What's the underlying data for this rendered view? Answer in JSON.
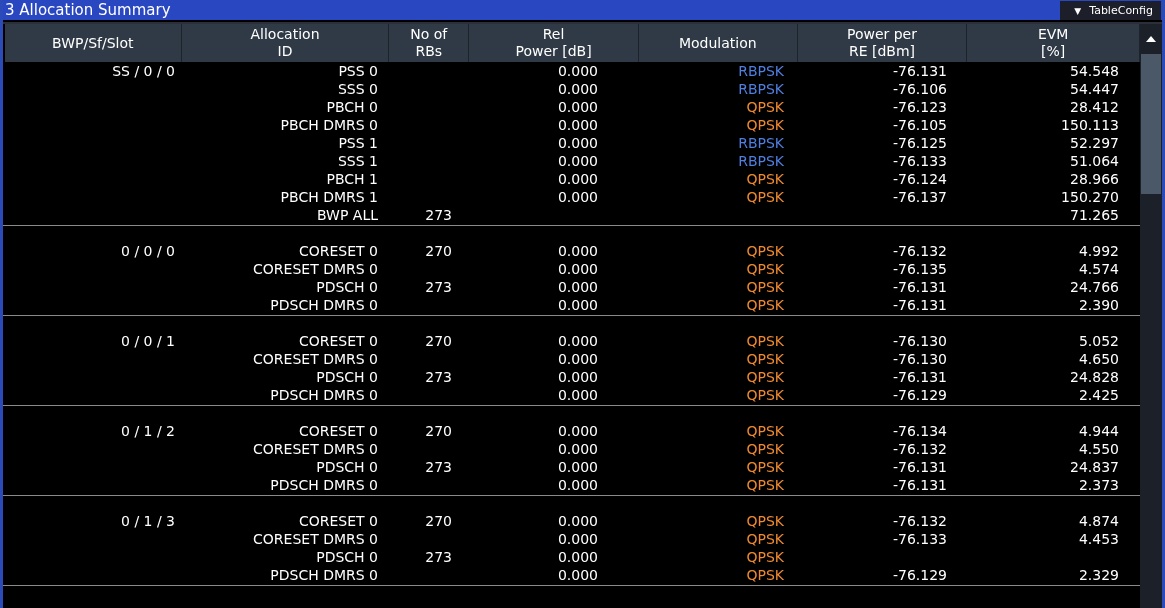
{
  "window": {
    "title": "3 Allocation Summary",
    "config_button": "TableConfig",
    "config_caret": "▼"
  },
  "table": {
    "columns": [
      {
        "label": "BWP/Sf/Slot"
      },
      {
        "label": "Allocation\nID"
      },
      {
        "label": "No of\nRBs"
      },
      {
        "label": "Rel\nPower [dB]"
      },
      {
        "label": "Modulation"
      },
      {
        "label": "Power per\nRE [dBm]"
      },
      {
        "label": "EVM\n[%]"
      }
    ],
    "groups": [
      {
        "slot": "SS / 0 / 0",
        "rows": [
          {
            "id": "PSS 0",
            "rel": "0.000",
            "mod": "RBPSK",
            "color": "#4f7fe0",
            "power": "-76.131",
            "evm": "54.548"
          },
          {
            "id": "SSS 0",
            "rel": "0.000",
            "mod": "RBPSK",
            "color": "#4f7fe0",
            "power": "-76.106",
            "evm": "54.447"
          },
          {
            "id": "PBCH 0",
            "rel": "0.000",
            "mod": "QPSK",
            "color": "#f08a30",
            "power": "-76.123",
            "evm": "28.412"
          },
          {
            "id": "PBCH DMRS 0",
            "rel": "0.000",
            "mod": "QPSK",
            "color": "#f08a30",
            "power": "-76.105",
            "evm": "150.113"
          },
          {
            "id": "PSS 1",
            "rel": "0.000",
            "mod": "RBPSK",
            "color": "#4f7fe0",
            "power": "-76.125",
            "evm": "52.297"
          },
          {
            "id": "SSS 1",
            "rel": "0.000",
            "mod": "RBPSK",
            "color": "#4f7fe0",
            "power": "-76.133",
            "evm": "51.064"
          },
          {
            "id": "PBCH 1",
            "rel": "0.000",
            "mod": "QPSK",
            "color": "#f08a30",
            "power": "-76.124",
            "evm": "28.966"
          },
          {
            "id": "PBCH DMRS 1",
            "rel": "0.000",
            "mod": "QPSK",
            "color": "#f08a30",
            "power": "-76.137",
            "evm": "150.270"
          },
          {
            "id": "BWP ALL",
            "rbs": "273",
            "evm": "71.265"
          }
        ]
      },
      {
        "slot": "0 / 0 / 0",
        "rows": [
          {
            "id": "CORESET 0",
            "rbs": "270",
            "rel": "0.000",
            "mod": "QPSK",
            "color": "#f08a30",
            "power": "-76.132",
            "evm": "4.992"
          },
          {
            "id": "CORESET DMRS 0",
            "rel": "0.000",
            "mod": "QPSK",
            "color": "#f08a30",
            "power": "-76.135",
            "evm": "4.574"
          },
          {
            "id": "PDSCH 0",
            "rbs": "273",
            "rel": "0.000",
            "mod": "QPSK",
            "color": "#f08a30",
            "power": "-76.131",
            "evm": "24.766"
          },
          {
            "id": "PDSCH DMRS 0",
            "rel": "0.000",
            "mod": "QPSK",
            "color": "#f08a30",
            "power": "-76.131",
            "evm": "2.390"
          }
        ]
      },
      {
        "slot": "0 / 0 / 1",
        "rows": [
          {
            "id": "CORESET 0",
            "rbs": "270",
            "rel": "0.000",
            "mod": "QPSK",
            "color": "#f08a30",
            "power": "-76.130",
            "evm": "5.052"
          },
          {
            "id": "CORESET DMRS 0",
            "rel": "0.000",
            "mod": "QPSK",
            "color": "#f08a30",
            "power": "-76.130",
            "evm": "4.650"
          },
          {
            "id": "PDSCH 0",
            "rbs": "273",
            "rel": "0.000",
            "mod": "QPSK",
            "color": "#f08a30",
            "power": "-76.131",
            "evm": "24.828"
          },
          {
            "id": "PDSCH DMRS 0",
            "rel": "0.000",
            "mod": "QPSK",
            "color": "#f08a30",
            "power": "-76.129",
            "evm": "2.425"
          }
        ]
      },
      {
        "slot": "0 / 1 / 2",
        "rows": [
          {
            "id": "CORESET 0",
            "rbs": "270",
            "rel": "0.000",
            "mod": "QPSK",
            "color": "#f08a30",
            "power": "-76.134",
            "evm": "4.944"
          },
          {
            "id": "CORESET DMRS 0",
            "rel": "0.000",
            "mod": "QPSK",
            "color": "#f08a30",
            "power": "-76.132",
            "evm": "4.550"
          },
          {
            "id": "PDSCH 0",
            "rbs": "273",
            "rel": "0.000",
            "mod": "QPSK",
            "color": "#f08a30",
            "power": "-76.131",
            "evm": "24.837"
          },
          {
            "id": "PDSCH DMRS 0",
            "rel": "0.000",
            "mod": "QPSK",
            "color": "#f08a30",
            "power": "-76.131",
            "evm": "2.373"
          }
        ]
      },
      {
        "slot": "0 / 1 / 3",
        "rows": [
          {
            "id": "CORESET 0",
            "rbs": "270",
            "rel": "0.000",
            "mod": "QPSK",
            "color": "#f08a30",
            "power": "-76.132",
            "evm": "4.874"
          },
          {
            "id": "CORESET DMRS 0",
            "rel": "0.000",
            "mod": "QPSK",
            "color": "#f08a30",
            "power": "-76.133",
            "evm": "4.453"
          },
          {
            "id": "PDSCH 0",
            "rbs": "273",
            "rel": "0.000",
            "mod": "QPSK",
            "color": "#f08a30"
          },
          {
            "id": "PDSCH DMRS 0",
            "rel": "0.000",
            "mod": "QPSK",
            "color": "#f08a30",
            "power": "-76.129",
            "evm": "2.329"
          }
        ]
      }
    ]
  }
}
